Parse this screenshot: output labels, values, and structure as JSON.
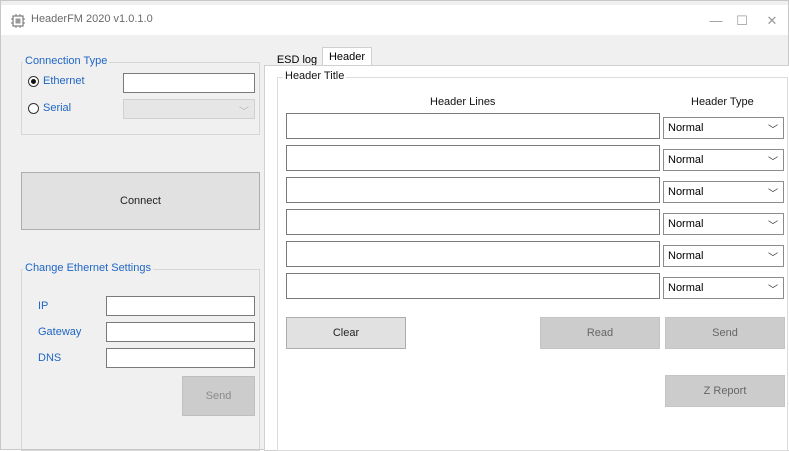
{
  "window": {
    "title": "HeaderFM 2020 v1.0.1.0",
    "controls": {
      "minimize": "—",
      "maximize": "☐",
      "close": "✕"
    }
  },
  "connection_type": {
    "legend": "Connection Type",
    "ethernet_label": "Ethernet",
    "serial_label": "Serial",
    "ethernet_value": "",
    "serial_selected": "",
    "selected": "Ethernet"
  },
  "connect_button": "Connect",
  "ethernet_settings": {
    "legend": "Change Ethernet Settings",
    "ip_label": "IP",
    "gateway_label": "Gateway",
    "dns_label": "DNS",
    "ip_value": "",
    "gateway_value": "",
    "dns_value": "",
    "send_label": "Send"
  },
  "tabs": [
    {
      "label": "ESD log",
      "active": false
    },
    {
      "label": "Header",
      "active": true
    }
  ],
  "header_panel": {
    "group_title": "Header Title",
    "col_lines": "Header Lines",
    "col_type": "Header Type",
    "rows": [
      {
        "line": "",
        "type": "Normal"
      },
      {
        "line": "",
        "type": "Normal"
      },
      {
        "line": "",
        "type": "Normal"
      },
      {
        "line": "",
        "type": "Normal"
      },
      {
        "line": "",
        "type": "Normal"
      },
      {
        "line": "",
        "type": "Normal"
      }
    ],
    "buttons": {
      "clear": "Clear",
      "read": "Read",
      "send": "Send",
      "z_report": "Z Report"
    }
  }
}
